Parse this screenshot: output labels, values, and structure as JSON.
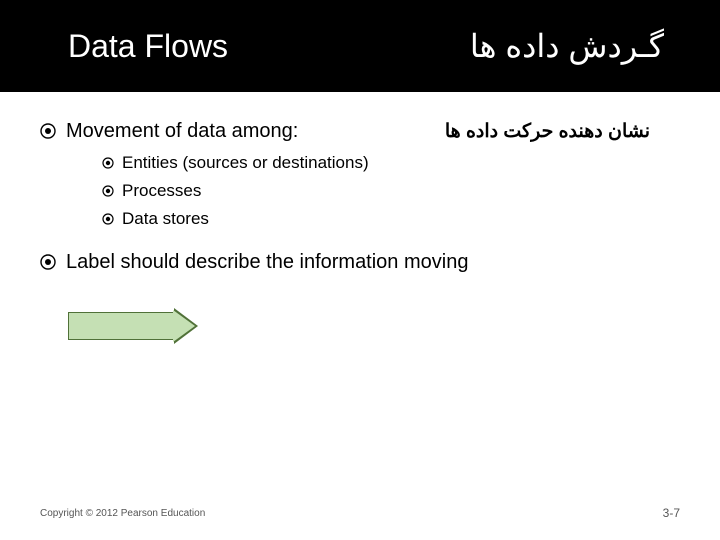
{
  "header": {
    "title_en": "Data Flows",
    "title_fa": "گـردش داده ها"
  },
  "content": {
    "item1_en": "Movement of data among:",
    "item1_fa": "نشان دهنده حرکت داده ها",
    "sub": {
      "a": "Entities (sources or destinations)",
      "b": "Processes",
      "c": "Data stores"
    },
    "item2": "Label should describe the information moving"
  },
  "footer": {
    "copyright": "Copyright © 2012 Pearson Education",
    "page": "3-7"
  }
}
